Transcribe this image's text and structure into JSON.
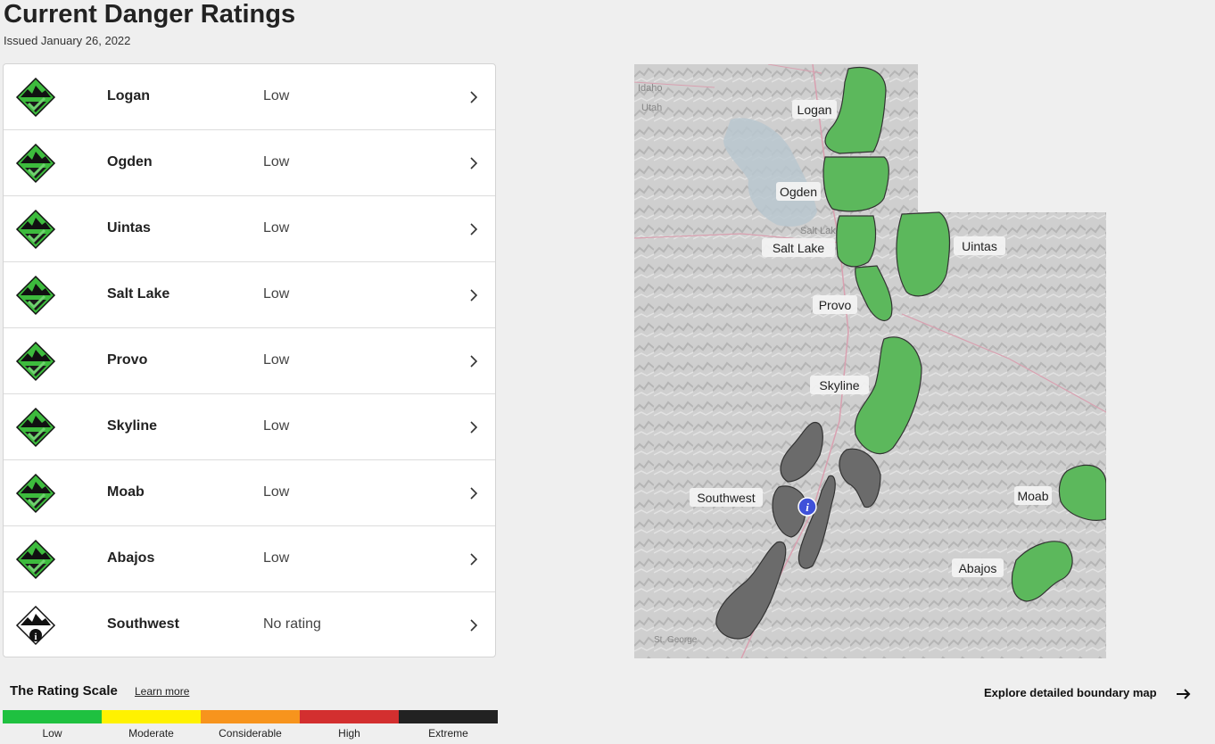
{
  "page": {
    "title": "Current Danger Ratings",
    "issued": "Issued January 26, 2022"
  },
  "regions": [
    {
      "name": "Logan",
      "rating": "Low",
      "icon": "low-danger-icon"
    },
    {
      "name": "Ogden",
      "rating": "Low",
      "icon": "low-danger-icon"
    },
    {
      "name": "Uintas",
      "rating": "Low",
      "icon": "low-danger-icon"
    },
    {
      "name": "Salt Lake",
      "rating": "Low",
      "icon": "low-danger-icon"
    },
    {
      "name": "Provo",
      "rating": "Low",
      "icon": "low-danger-icon"
    },
    {
      "name": "Skyline",
      "rating": "Low",
      "icon": "low-danger-icon"
    },
    {
      "name": "Moab",
      "rating": "Low",
      "icon": "low-danger-icon"
    },
    {
      "name": "Abajos",
      "rating": "Low",
      "icon": "low-danger-icon"
    },
    {
      "name": "Southwest",
      "rating": "No rating",
      "icon": "no-rating-icon"
    }
  ],
  "scale": {
    "title": "The Rating Scale",
    "learn_more": "Learn more",
    "levels": [
      {
        "label": "Low",
        "color": "#1fc140"
      },
      {
        "label": "Moderate",
        "color": "#fff200"
      },
      {
        "label": "Considerable",
        "color": "#f7941d"
      },
      {
        "label": "High",
        "color": "#d32f2f"
      },
      {
        "label": "Extreme",
        "color": "#222222"
      }
    ]
  },
  "map": {
    "state_labels": [
      "Idaho",
      "Utah"
    ],
    "faint_labels": [
      "Salt Lake",
      "St. George"
    ],
    "region_labels": [
      "Logan",
      "Ogden",
      "Salt Lake",
      "Uintas",
      "Provo",
      "Skyline",
      "Southwest",
      "Moab",
      "Abajos"
    ],
    "low_color": "#5cb85c",
    "no_rating_color": "#6b6b6b"
  },
  "explore": {
    "label": "Explore detailed boundary map"
  }
}
